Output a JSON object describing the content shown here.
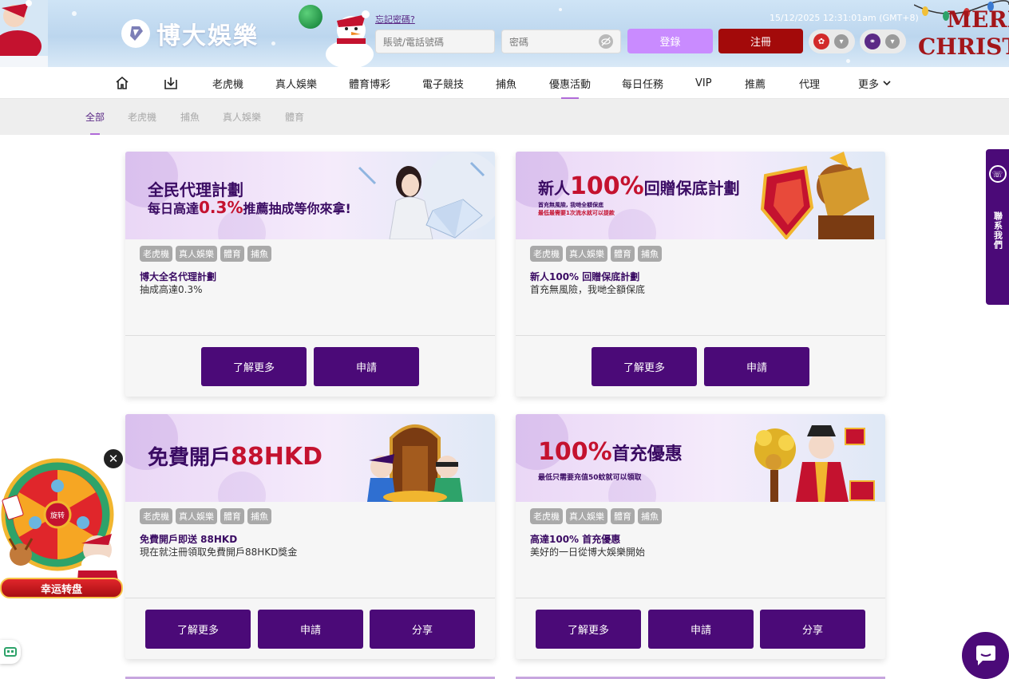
{
  "header": {
    "logo_text": "博大娛樂",
    "forgot_password": "忘記密碼?",
    "account_placeholder": "賬號/電話號碼",
    "password_placeholder": "密碼",
    "login_label": "登錄",
    "register_label": "注冊",
    "datetime": "15/12/2025 12:31:01am (GMT+8)",
    "xmas_line1": "MERR",
    "xmas_line2": "CHRISTM",
    "colors": {
      "login": "#c98bff",
      "register": "#a30a0a"
    }
  },
  "nav": {
    "items": [
      "老虎機",
      "真人娛樂",
      "體育博彩",
      "電子競技",
      "捕魚",
      "優惠活動",
      "每日任務",
      "VIP",
      "推薦",
      "代理",
      "更多"
    ],
    "active": "優惠活動"
  },
  "subnav": {
    "items": [
      "全部",
      "老虎機",
      "捕魚",
      "真人娛樂",
      "體育"
    ],
    "active": "全部"
  },
  "cards": [
    {
      "banner_title": "全民代理計劃",
      "banner_sub_pre": "每日高達",
      "banner_sub_hl": "0.3%",
      "banner_sub_post": "推薦抽成等你來拿!",
      "tags": [
        "老虎機",
        "真人娛樂",
        "體育",
        "捕魚"
      ],
      "title": "博大全名代理計劃",
      "desc": "抽成高達0.3%",
      "buttons": [
        "了解更多",
        "申請"
      ]
    },
    {
      "banner_pre": "新人",
      "banner_hl": "100%",
      "banner_post": "回贈保底計劃",
      "banner_small1": "首充無風險, 我哋全額保底",
      "banner_small2": "最低最需要1次流水就可以提款",
      "tags": [
        "老虎機",
        "真人娛樂",
        "體育",
        "捕魚"
      ],
      "title": "新人100% 回贈保底計劃",
      "desc": "首充無風險，我哋全額保底",
      "buttons": [
        "了解更多",
        "申請"
      ]
    },
    {
      "banner_pre": "免費開戶",
      "banner_hl": "88HKD",
      "tags": [
        "老虎機",
        "真人娛樂",
        "體育",
        "捕魚"
      ],
      "title": "免費開戶即送 88HKD",
      "desc": "現在就注冊領取免費開戶88HKD獎金",
      "buttons": [
        "了解更多",
        "申請",
        "分享"
      ]
    },
    {
      "banner_hl": "100%",
      "banner_post": "首充優惠",
      "banner_small1": "最低只需要充值50蚊就可以領取",
      "tags": [
        "老虎機",
        "真人娛樂",
        "體育",
        "捕魚"
      ],
      "title": "高達100% 首充優惠",
      "desc": "美好的一日從博大娛樂開始",
      "buttons": [
        "了解更多",
        "申請",
        "分享"
      ]
    }
  ],
  "side_tab": {
    "label": "聯系我們"
  },
  "wheel": {
    "label": "幸运转盘",
    "spin": "旋转"
  },
  "icons": {
    "home": "home-icon",
    "download": "download-icon",
    "chevron": "chevron-down-icon",
    "eye": "eye-off-icon",
    "chat": "chat-icon",
    "phone": "phone-icon",
    "close": "close-icon",
    "bot": "bot-icon"
  }
}
